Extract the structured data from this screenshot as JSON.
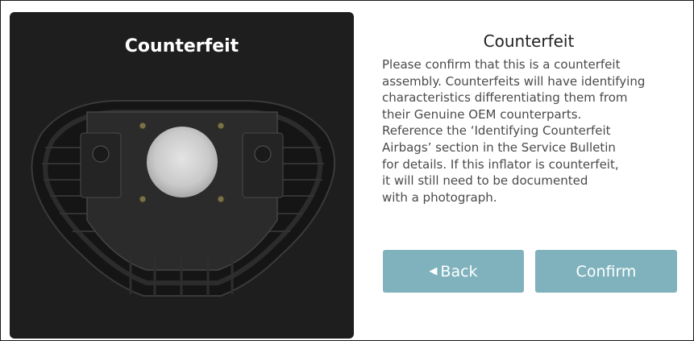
{
  "photo": {
    "title": "Counterfeit",
    "image_subject": "airbag-inflator-assembly-photo"
  },
  "info": {
    "title": "Counterfeit",
    "lines": [
      "Please confirm that this is a counterfeit",
      "assembly. Counterfeits will have identifying",
      "characteristics differentiating them from",
      "their Genuine OEM counterparts.",
      "Reference the ‘Identifying Counterfeit",
      "Airbags’ section in the Service Bulletin",
      "for details. If this inflator is counterfeit,",
      "it will still need to be documented",
      "with a photograph."
    ]
  },
  "buttons": {
    "back_icon": "◀",
    "back_label": "Back",
    "confirm_label": "Confirm"
  },
  "colors": {
    "button_bg": "#7fb2bd",
    "panel_bg": "#1e1e1e"
  }
}
